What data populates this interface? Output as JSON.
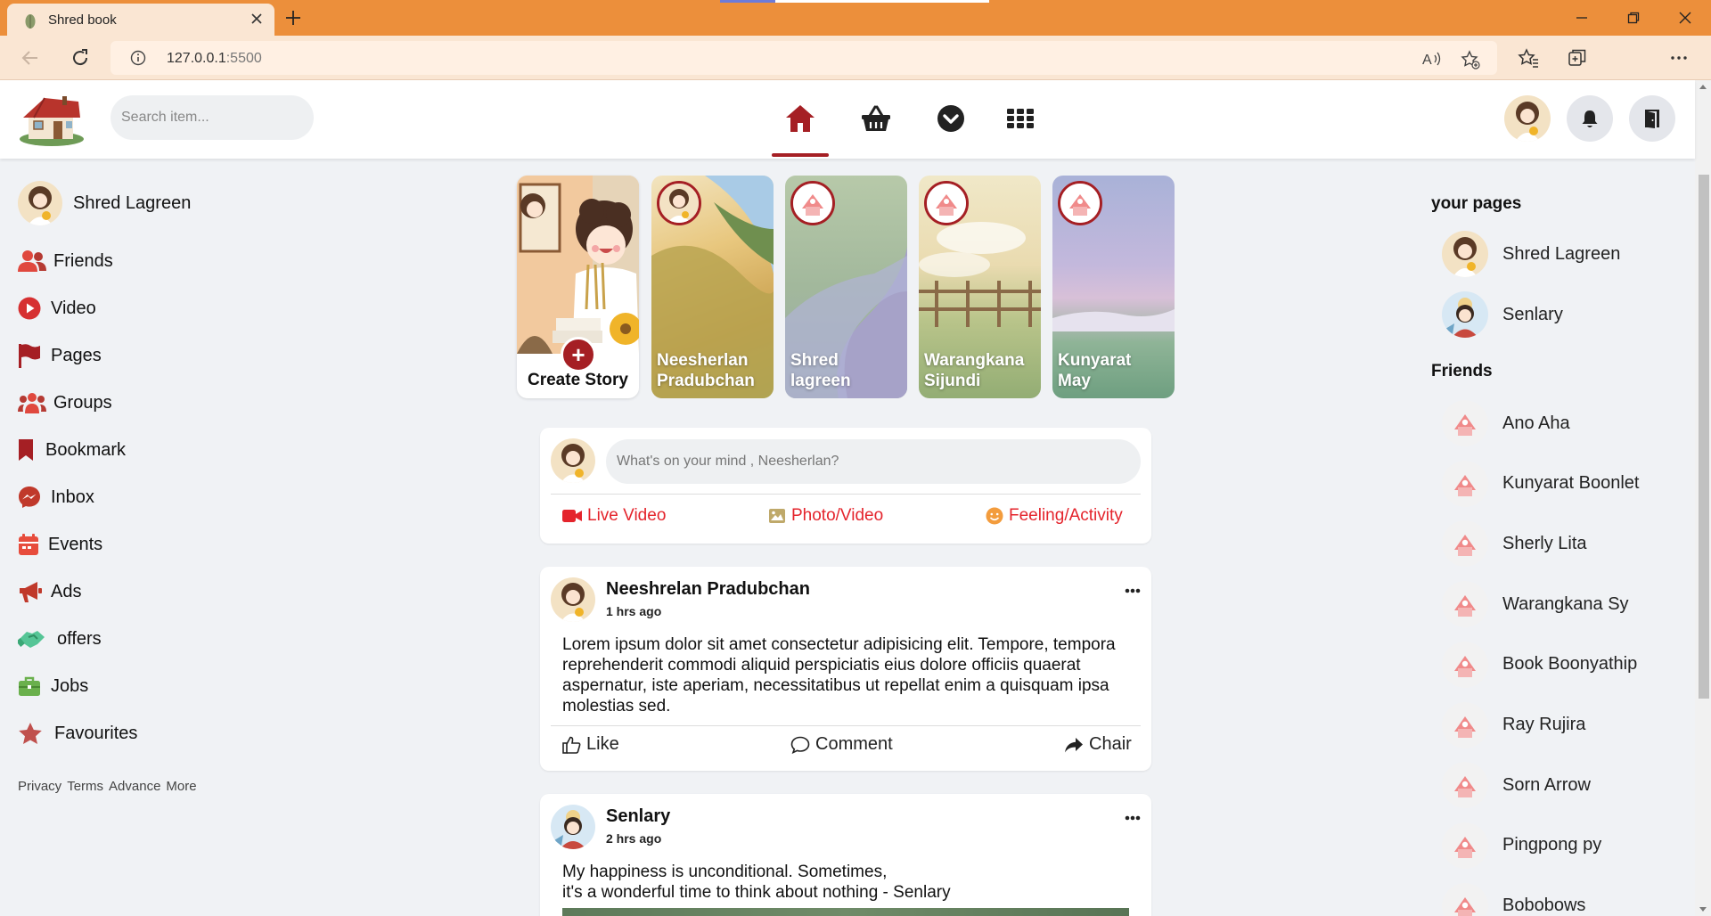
{
  "browser": {
    "tab_title": "Shred book",
    "url_host": "127.0.0.1",
    "url_port": ":5500"
  },
  "colors": {
    "brand": "#a51f24",
    "accent": "#e4242c",
    "chrome": "#ec8f3b",
    "chrome_light": "#fae6d3"
  },
  "header": {
    "search_placeholder": "Search item...",
    "nav_icons": [
      "home-icon",
      "basket-icon",
      "chevron-down-circle-icon",
      "apps-grid-icon"
    ],
    "active_nav": "home"
  },
  "profile": {
    "name": "Shred Lagreen"
  },
  "sidebar": {
    "items": [
      {
        "label": "Friends",
        "icon": "friends-icon"
      },
      {
        "label": "Video",
        "icon": "video-play-icon"
      },
      {
        "label": "Pages",
        "icon": "flag-icon"
      },
      {
        "label": "Groups",
        "icon": "groups-icon"
      },
      {
        "label": "Bookmark",
        "icon": "bookmark-icon"
      },
      {
        "label": "Inbox",
        "icon": "messenger-icon"
      },
      {
        "label": "Events",
        "icon": "calendar-icon"
      },
      {
        "label": "Ads",
        "icon": "megaphone-icon"
      },
      {
        "label": "offers",
        "icon": "handshake-icon"
      },
      {
        "label": "Jobs",
        "icon": "briefcase-icon"
      },
      {
        "label": "Favourites",
        "icon": "star-icon"
      }
    ],
    "footer_links": [
      "Privacy",
      "Terms",
      "Advance",
      "More"
    ]
  },
  "stories": {
    "create_label": "Create Story",
    "items": [
      {
        "name_line1": "Neesherlan",
        "name_line2": "Pradubchan"
      },
      {
        "name_line1": "Shred",
        "name_line2": "lagreen"
      },
      {
        "name_line1": "Warangkana",
        "name_line2": "Sijundi"
      },
      {
        "name_line1": "Kunyarat",
        "name_line2": "May"
      }
    ]
  },
  "composer": {
    "placeholder": "What's on your mind , Neesherlan?",
    "actions": [
      "Live Video",
      "Photo/Video",
      "Feeling/Activity"
    ]
  },
  "posts": [
    {
      "author": "Neeshrelan Pradubchan",
      "time": "1 hrs ago",
      "text": "Lorem ipsum dolor sit amet consectetur adipisicing elit. Tempore, tempora reprehenderit commodi aliquid perspiciatis eius dolore officiis quaerat aspernatur, iste aperiam, necessitatibus ut repellat enim a quisquam ipsa molestias sed.",
      "actions": [
        "Like",
        "Comment",
        "Chair"
      ]
    },
    {
      "author": "Senlary",
      "time": "2 hrs ago",
      "text_line1": "My happiness is unconditional. Sometimes,",
      "text_line2": "it's a wonderful time to think about nothing - Senlary"
    }
  ],
  "right": {
    "pages_title": "your pages",
    "pages": [
      "Shred Lagreen",
      "Senlary"
    ],
    "friends_title": "Friends",
    "friends": [
      "Ano Aha",
      "Kunyarat Boonlet",
      "Sherly Lita",
      "Warangkana Sy",
      "Book Boonyathip",
      "Ray Rujira",
      "Sorn Arrow",
      "Pingpong py",
      "Bobobows"
    ]
  }
}
